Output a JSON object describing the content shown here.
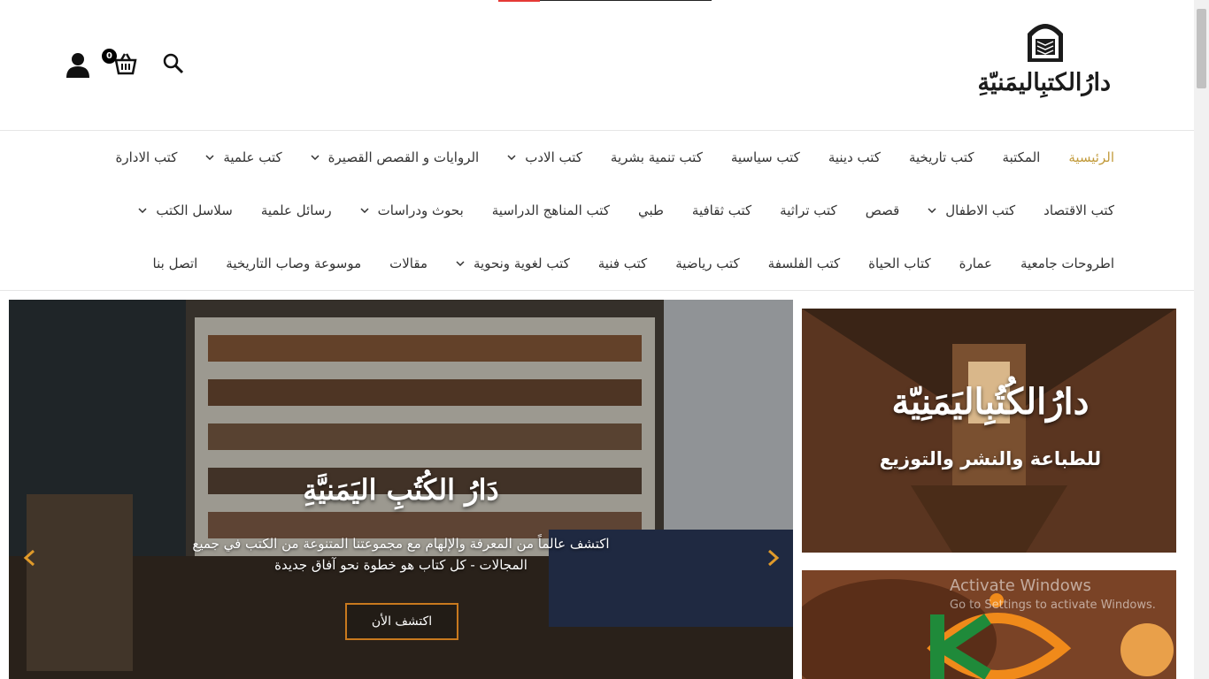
{
  "brand": {
    "logo_text": "دارُالكتبِاليمَنيّةِ",
    "accent_color": "#c29b3c"
  },
  "header": {
    "cart_count": "0",
    "icons": [
      "search-icon",
      "cart-icon",
      "user-icon"
    ]
  },
  "nav": {
    "row1": [
      {
        "label": "الرئيسية",
        "active": true,
        "dropdown": false
      },
      {
        "label": "المكتبة",
        "dropdown": false
      },
      {
        "label": "كتب تاريخية",
        "dropdown": false
      },
      {
        "label": "كتب دينية",
        "dropdown": false
      },
      {
        "label": "كتب سياسية",
        "dropdown": false
      },
      {
        "label": "كتب تنمية بشرية",
        "dropdown": false
      },
      {
        "label": "كتب الادب",
        "dropdown": true
      },
      {
        "label": "الروايات و القصص القصيرة",
        "dropdown": true
      },
      {
        "label": "كتب علمية",
        "dropdown": true
      },
      {
        "label": "كتب الادارة",
        "dropdown": false
      }
    ],
    "row2": [
      {
        "label": "كتب الاقتصاد",
        "dropdown": false
      },
      {
        "label": "كتب الاطفال",
        "dropdown": true
      },
      {
        "label": "قصص",
        "dropdown": false
      },
      {
        "label": "كتب تراثية",
        "dropdown": false
      },
      {
        "label": "كتب ثقافية",
        "dropdown": false
      },
      {
        "label": "طبي",
        "dropdown": false
      },
      {
        "label": "كتب المناهج الدراسية",
        "dropdown": false
      },
      {
        "label": "بحوث ودراسات",
        "dropdown": true
      },
      {
        "label": "رسائل علمية",
        "dropdown": false
      },
      {
        "label": "سلاسل الكتب",
        "dropdown": true
      }
    ],
    "row3": [
      {
        "label": "اطروحات جامعية",
        "dropdown": false
      },
      {
        "label": "عمارة",
        "dropdown": false
      },
      {
        "label": "كتاب الحياة",
        "dropdown": false
      },
      {
        "label": "كتب الفلسفة",
        "dropdown": false
      },
      {
        "label": "كتب رياضية",
        "dropdown": false
      },
      {
        "label": "كتب فنية",
        "dropdown": false
      },
      {
        "label": "كتب لغوية ونحوية",
        "dropdown": true
      },
      {
        "label": "مقالات",
        "dropdown": false
      },
      {
        "label": "موسوعة وصاب التاريخية",
        "dropdown": false
      },
      {
        "label": "اتصل بنا",
        "dropdown": false
      }
    ]
  },
  "hero": {
    "title": "دَارُ الكُتُبِ اليَمَنيَّةِ",
    "text": "اكتشف عالماً من المعرفة والإلهام مع مجموعتنا المتنوعة من الكتب في جميع المجالات - كل كتاب هو خطوة نحو آفاق جديدة",
    "button_label": "اكتشف الأن",
    "button_color": "#c8791e"
  },
  "banner1": {
    "title": "دارُالكُتُبِاليَمَنِيّة",
    "subtitle": "للطباعة والنشر والتوزيع"
  },
  "watermark": {
    "line1": "Activate Windows",
    "line2": "Go to Settings to activate Windows."
  }
}
